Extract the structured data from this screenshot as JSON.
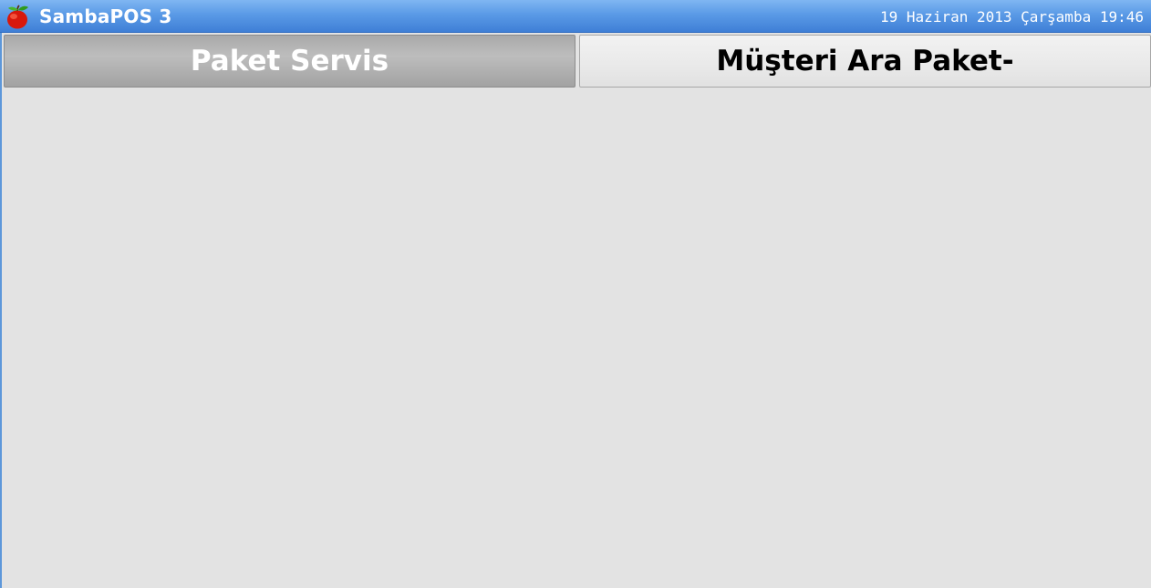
{
  "titlebar": {
    "app_icon": "apple-icon",
    "title": "SambaPOS 3",
    "datetime": "19 Haziran 2013 Çarşamba 19:46"
  },
  "tabs": [
    {
      "label": "Paket Servis",
      "active": true
    },
    {
      "label": "Müşteri Ara Paket-",
      "active": false
    }
  ],
  "colors": {
    "titlebar_accent": "#5a9ae6",
    "background": "#e3e3e3",
    "active_tab": "#b0b0b0",
    "inactive_tab": "#ebebeb"
  }
}
